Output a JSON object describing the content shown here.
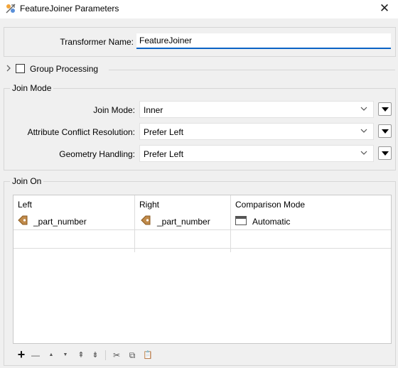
{
  "window": {
    "title": "FeatureJoiner Parameters",
    "close_glyph": "✕",
    "icon": "transformer-icon"
  },
  "transformer_name": {
    "label": "Transformer Name:",
    "value": "FeatureJoiner"
  },
  "group_processing": {
    "label": "Group Processing",
    "checked": false,
    "expanded": false
  },
  "join_mode_section": {
    "title": "Join Mode",
    "fields": [
      {
        "label": "Join Mode:",
        "value": "Inner"
      },
      {
        "label": "Attribute Conflict Resolution:",
        "value": "Prefer Left"
      },
      {
        "label": "Geometry Handling:",
        "value": "Prefer Left"
      }
    ]
  },
  "join_on_section": {
    "title": "Join On",
    "columns": [
      "Left",
      "Right",
      "Comparison Mode"
    ],
    "rows": [
      {
        "left": "_part_number",
        "right": "_part_number",
        "mode": "Automatic"
      }
    ]
  },
  "toolbar": {
    "add": "+",
    "remove": "—",
    "move_up": "▲",
    "move_down": "▼",
    "move_top": "⇞",
    "move_bottom": "⇟",
    "cut": "✂",
    "copy": "⧉",
    "paste": "📋"
  },
  "colors": {
    "accent": "#0b63c5",
    "dialog_bg": "#f0f0f0",
    "attr_icon": "#c08a4a"
  }
}
